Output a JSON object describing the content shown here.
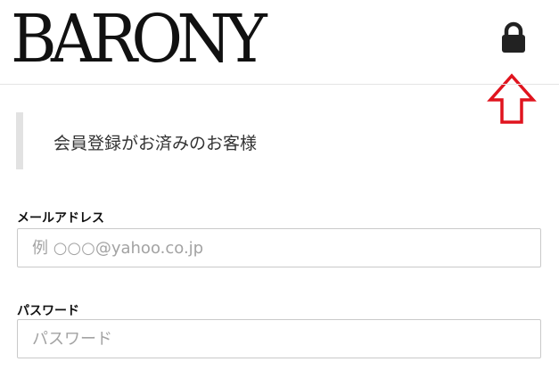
{
  "header": {
    "logo_text": "BARONY",
    "lock_icon": "lock-icon",
    "annotation_icon": "up-arrow-outline-icon",
    "annotation_color": "#e0141e"
  },
  "login": {
    "section_title": "会員登録がお済みのお客様",
    "email": {
      "label": "メールアドレス",
      "value": "",
      "placeholder": "例 ○○○@yahoo.co.jp"
    },
    "password": {
      "label": "パスワード",
      "value": "",
      "placeholder": "パスワード"
    }
  }
}
